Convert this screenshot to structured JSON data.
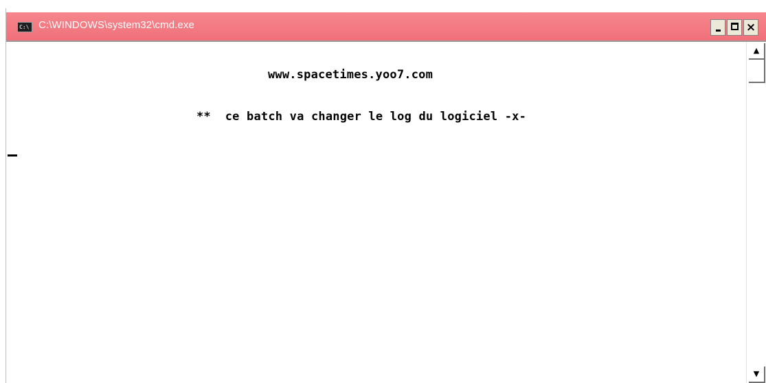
{
  "window": {
    "title": "C:\\WINDOWS\\system32\\cmd.exe",
    "app_icon_text": "C:\\",
    "titlebar_color": "#f0707a",
    "controls": {
      "minimize": "_",
      "maximize": "□",
      "close": "×"
    }
  },
  "console": {
    "lines": [
      "www.spacetimes.yoo7.com",
      "**  ce batch va changer le log du logiciel -x-"
    ]
  },
  "scrollbar": {
    "up_arrow": "▲",
    "down_arrow": "▼"
  }
}
